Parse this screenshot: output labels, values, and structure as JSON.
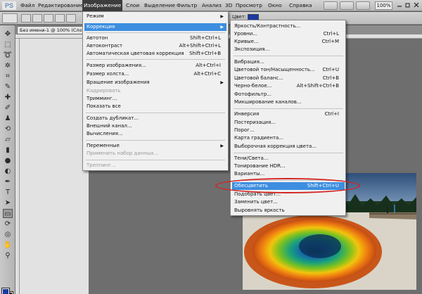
{
  "menubar": {
    "logo": "PS",
    "items": [
      "Файл",
      "Редактирование",
      "Изображение",
      "Слои",
      "Выделение",
      "Фильтр",
      "Анализ",
      "3D",
      "Просмотр",
      "Окно",
      "Справка"
    ],
    "zoom": "100%"
  },
  "options": {
    "color_label": "Цвет:",
    "color_value": "#1b3aa3"
  },
  "document_tab": "Без имени-1 @ 100% (Слой",
  "image_menu": {
    "items": [
      {
        "label": "Режим",
        "submenu": true
      },
      {
        "label": "Коррекция",
        "submenu": true,
        "highlighted": true
      },
      {
        "label": "Автотон",
        "shortcut": "Shift+Ctrl+L"
      },
      {
        "label": "Автоконтраст",
        "shortcut": "Alt+Shift+Ctrl+L"
      },
      {
        "label": "Автоматическая цветовая коррекция",
        "shortcut": "Shift+Ctrl+B"
      },
      {
        "label": "Размер изображения...",
        "shortcut": "Alt+Ctrl+I"
      },
      {
        "label": "Размер холста...",
        "shortcut": "Alt+Ctrl+C"
      },
      {
        "label": "Вращение изображения",
        "submenu": true
      },
      {
        "label": "Кадрировать",
        "disabled": true
      },
      {
        "label": "Тримминг..."
      },
      {
        "label": "Показать все"
      },
      {
        "label": "Создать дубликат..."
      },
      {
        "label": "Внешний канал..."
      },
      {
        "label": "Вычисления..."
      },
      {
        "label": "Переменные",
        "submenu": true
      },
      {
        "label": "Применить набор данных...",
        "disabled": true
      },
      {
        "label": "Треппинг...",
        "disabled": true
      }
    ]
  },
  "adjust_menu": {
    "items": [
      {
        "label": "Яркость/Контрастность..."
      },
      {
        "label": "Уровни...",
        "shortcut": "Ctrl+L"
      },
      {
        "label": "Кривые...",
        "shortcut": "Ctrl+M"
      },
      {
        "label": "Экспозиция..."
      },
      {
        "label": "Вибрация..."
      },
      {
        "label": "Цветовой тон/Насыщенность...",
        "shortcut": "Ctrl+U"
      },
      {
        "label": "Цветовой баланс...",
        "shortcut": "Ctrl+B"
      },
      {
        "label": "Черно-белое...",
        "shortcut": "Alt+Shift+Ctrl+B"
      },
      {
        "label": "Фотофильтр..."
      },
      {
        "label": "Микширование каналов..."
      },
      {
        "label": "Инверсия",
        "shortcut": "Ctrl+I"
      },
      {
        "label": "Постеризация..."
      },
      {
        "label": "Порог..."
      },
      {
        "label": "Карта градиента..."
      },
      {
        "label": "Выборочная коррекция цвета..."
      },
      {
        "label": "Тени/Света..."
      },
      {
        "label": "Тонирование HDR..."
      },
      {
        "label": "Варианты..."
      },
      {
        "label": "Обесцветить",
        "shortcut": "Shift+Ctrl+U",
        "highlighted": true
      },
      {
        "label": "Подобрать цвет..."
      },
      {
        "label": "Заменить цвет..."
      },
      {
        "label": "Выровнять яркость"
      }
    ]
  },
  "accent_colors": {
    "highlight": "#3d8ee0",
    "annotation_ellipse": "#d42424"
  }
}
